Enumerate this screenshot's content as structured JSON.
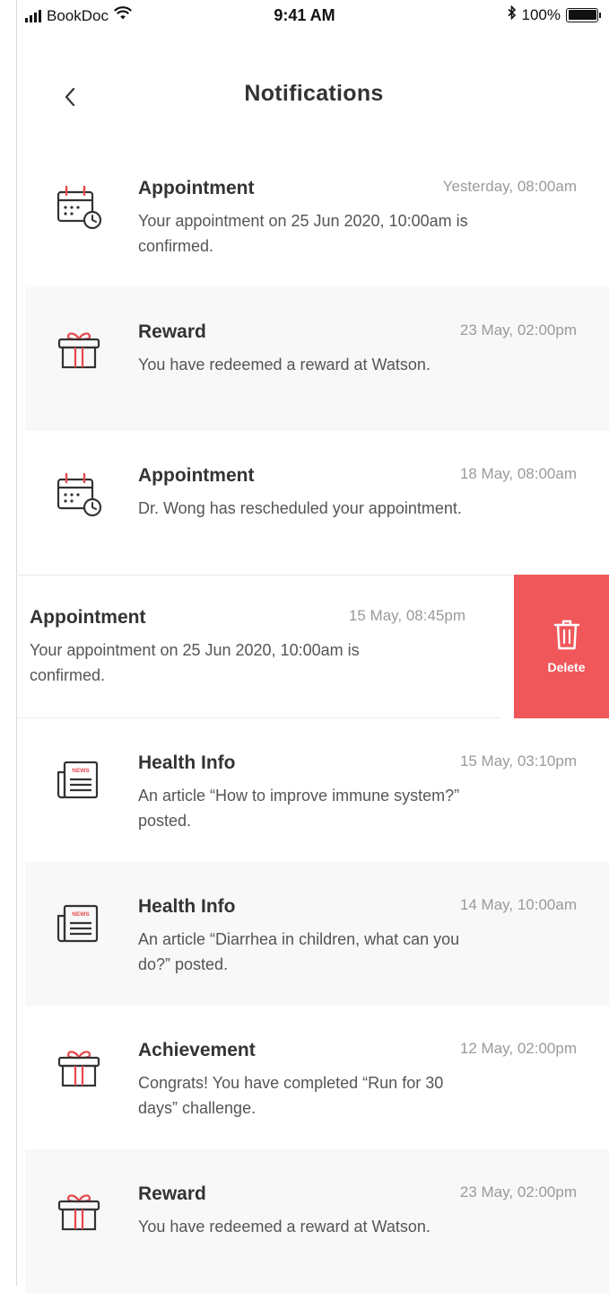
{
  "status_bar": {
    "carrier": "BookDoc",
    "time": "9:41 AM",
    "battery": "100%"
  },
  "header": {
    "title": "Notifications"
  },
  "colors": {
    "accent": "#f0575a",
    "icon_stroke": "#333333",
    "icon_accent": "#e8484c",
    "shaded_row": "#f8f8f8"
  },
  "notifications": [
    {
      "icon": "calendar-clock-icon",
      "title": "Appointment",
      "time": "Yesterday, 08:00am",
      "body": "Your appointment on 25 Jun 2020, 10:00am is confirmed."
    },
    {
      "icon": "gift-icon",
      "title": "Reward",
      "time": "23 May, 02:00pm",
      "body": "You have redeemed a reward at Watson."
    },
    {
      "icon": "calendar-clock-icon",
      "title": "Appointment",
      "time": "18 May, 08:00am",
      "body": "Dr. Wong has rescheduled your appointment."
    },
    {
      "icon": "none",
      "title": "Appointment",
      "time": "15 May, 08:45pm",
      "body": "Your appointment on 25 Jun 2020, 10:00am is confirmed.",
      "swiped": true,
      "action_label": "Delete"
    },
    {
      "icon": "newspaper-icon",
      "title": "Health Info",
      "time": "15 May, 03:10pm",
      "body": "An article “How to improve immune system?” posted."
    },
    {
      "icon": "newspaper-icon",
      "title": "Health Info",
      "time": "14 May, 10:00am",
      "body": "An article “Diarrhea in children, what can you do?” posted."
    },
    {
      "icon": "gift-icon",
      "title": "Achievement",
      "time": "12 May, 02:00pm",
      "body": "Congrats! You have completed “Run for 30 days” challenge."
    },
    {
      "icon": "gift-icon",
      "title": "Reward",
      "time": "23 May, 02:00pm",
      "body": "You have redeemed a reward at Watson."
    }
  ],
  "newspaper_icon_text": "NEWS"
}
